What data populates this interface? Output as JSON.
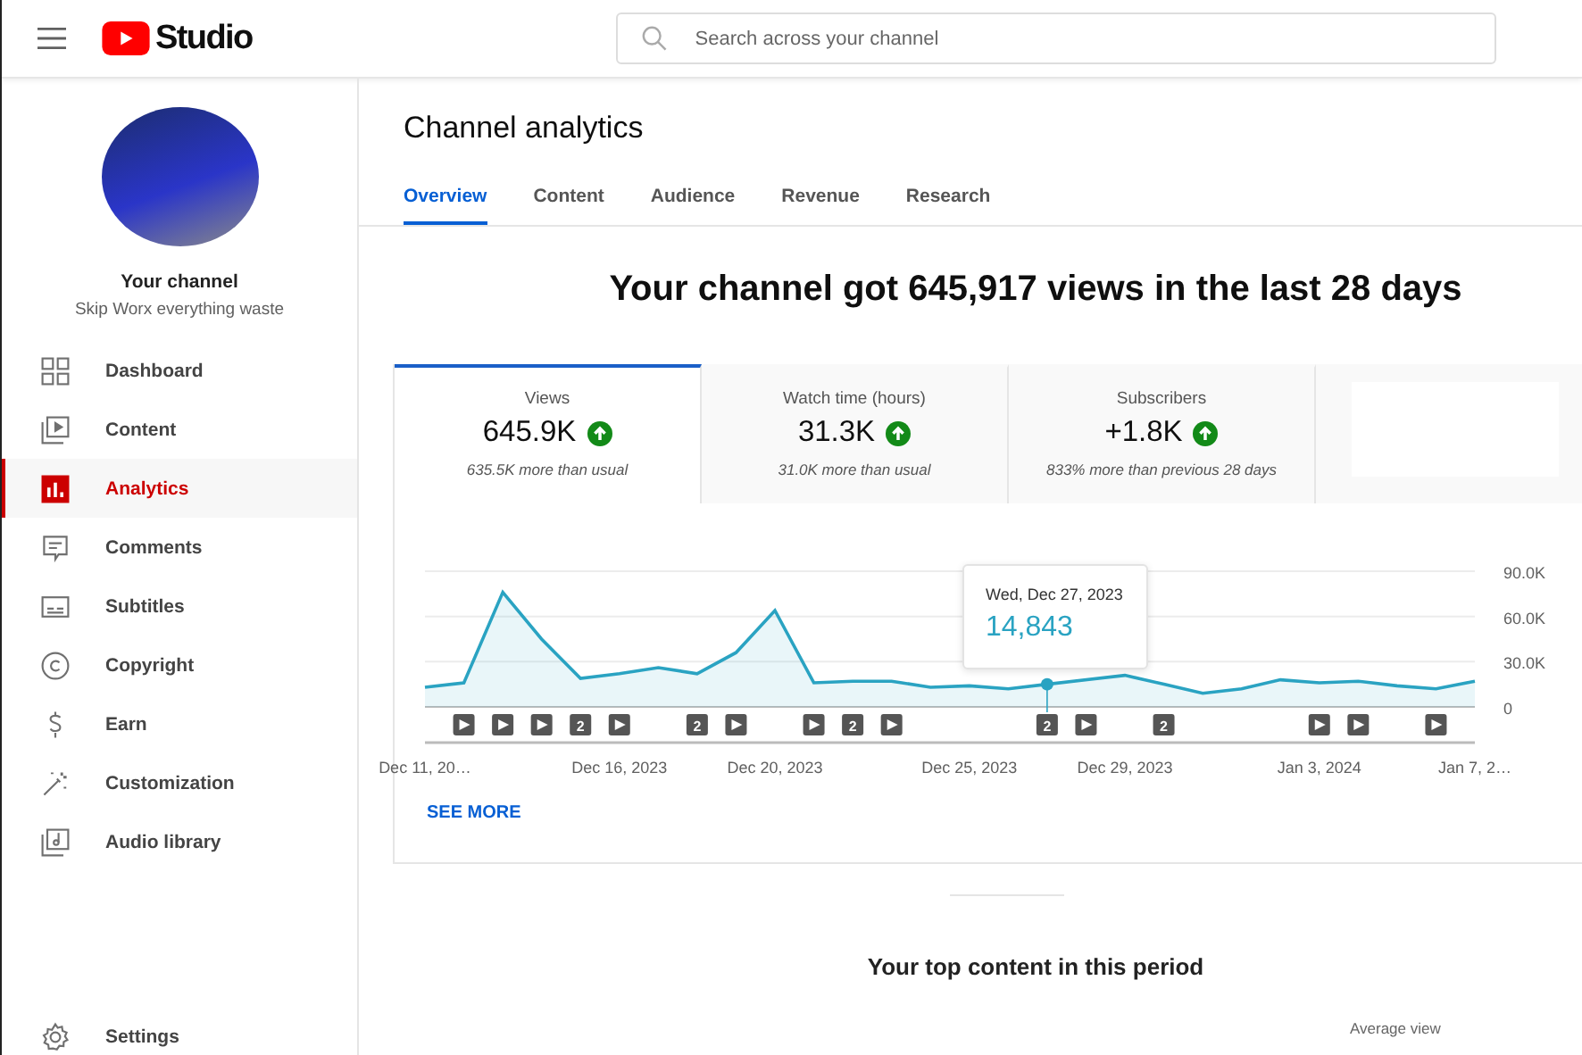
{
  "header": {
    "logo_text": "Studio",
    "search": {
      "placeholder": "Search across your channel"
    }
  },
  "sidebar": {
    "channel_title": "Your channel",
    "channel_name": "Skip Worx everything waste",
    "items": [
      {
        "label": "Dashboard",
        "kind": "dashboard",
        "selected": false
      },
      {
        "label": "Content",
        "kind": "content",
        "selected": false
      },
      {
        "label": "Analytics",
        "kind": "analytics",
        "selected": true
      },
      {
        "label": "Comments",
        "kind": "comments",
        "selected": false
      },
      {
        "label": "Subtitles",
        "kind": "subtitles",
        "selected": false
      },
      {
        "label": "Copyright",
        "kind": "copyright",
        "selected": false
      },
      {
        "label": "Earn",
        "kind": "earn",
        "selected": false
      },
      {
        "label": "Customization",
        "kind": "customization",
        "selected": false
      },
      {
        "label": "Audio library",
        "kind": "audio",
        "selected": false
      }
    ],
    "footer_item": {
      "label": "Settings",
      "kind": "settings",
      "selected": false
    }
  },
  "page": {
    "title": "Channel analytics",
    "tabs": [
      {
        "label": "Overview",
        "selected": true
      },
      {
        "label": "Content",
        "selected": false
      },
      {
        "label": "Audience",
        "selected": false
      },
      {
        "label": "Revenue",
        "selected": false
      },
      {
        "label": "Research",
        "selected": false
      }
    ],
    "headline": "Your channel got 645,917 views in the last 28 days",
    "metrics": [
      {
        "label": "Views",
        "value": "645.9K",
        "note": "635.5K more than usual",
        "selected": true
      },
      {
        "label": "Watch time (hours)",
        "value": "31.3K",
        "note": "31.0K more than usual",
        "selected": false
      },
      {
        "label": "Subscribers",
        "value": "+1.8K",
        "note": "833% more than previous 28 days",
        "selected": false
      }
    ],
    "chart_data": {
      "type": "area",
      "categories": [
        "Dec 11, 20…",
        null,
        null,
        null,
        null,
        "Dec 16, 2023",
        null,
        null,
        null,
        "Dec 20, 2023",
        null,
        null,
        null,
        null,
        "Dec 25, 2023",
        null,
        null,
        null,
        "Dec 29, 2023",
        null,
        null,
        null,
        null,
        "Jan 3, 2024",
        null,
        null,
        null,
        "Jan 7, 2…"
      ],
      "series": [
        {
          "color": "#2aa3c2",
          "values": [
            13000,
            16000,
            76000,
            45000,
            19000,
            22000,
            26000,
            22000,
            36000,
            64000,
            16000,
            17000,
            17000,
            13000,
            14000,
            12000,
            15000,
            null,
            21000,
            15000,
            9000,
            12000,
            18000,
            16000,
            17000,
            14000,
            12000,
            17000
          ]
        }
      ],
      "ylim": [
        0,
        90000
      ],
      "yticks": [
        {
          "value": 0,
          "label": "0"
        },
        {
          "value": 30000,
          "label": "30.0K"
        },
        {
          "value": 60000,
          "label": "60.0K"
        },
        {
          "value": 90000,
          "label": "90.0K"
        }
      ]
    },
    "days": [
      {
        "kind": "none"
      },
      {
        "kind": "video"
      },
      {
        "kind": "video"
      },
      {
        "kind": "video"
      },
      {
        "kind": "count",
        "label": "2"
      },
      {
        "kind": "video"
      },
      {
        "kind": "none"
      },
      {
        "kind": "count",
        "label": "2"
      },
      {
        "kind": "video"
      },
      {
        "kind": "none"
      },
      {
        "kind": "video"
      },
      {
        "kind": "count",
        "label": "2"
      },
      {
        "kind": "video"
      },
      {
        "kind": "none"
      },
      {
        "kind": "none"
      },
      {
        "kind": "none"
      },
      {
        "kind": "count",
        "label": "2",
        "tooltip": {
          "date": "Wed, Dec 27, 2023",
          "value": "14,843"
        }
      },
      {
        "kind": "video"
      },
      {
        "kind": "none"
      },
      {
        "kind": "count",
        "label": "2"
      },
      {
        "kind": "none"
      },
      {
        "kind": "none"
      },
      {
        "kind": "none"
      },
      {
        "kind": "video"
      },
      {
        "kind": "video"
      },
      {
        "kind": "none"
      },
      {
        "kind": "video"
      },
      {
        "kind": "none"
      }
    ],
    "see_more": "SEE MORE",
    "top_content": {
      "title": "Your top content in this period",
      "column_3": "Average view"
    }
  }
}
